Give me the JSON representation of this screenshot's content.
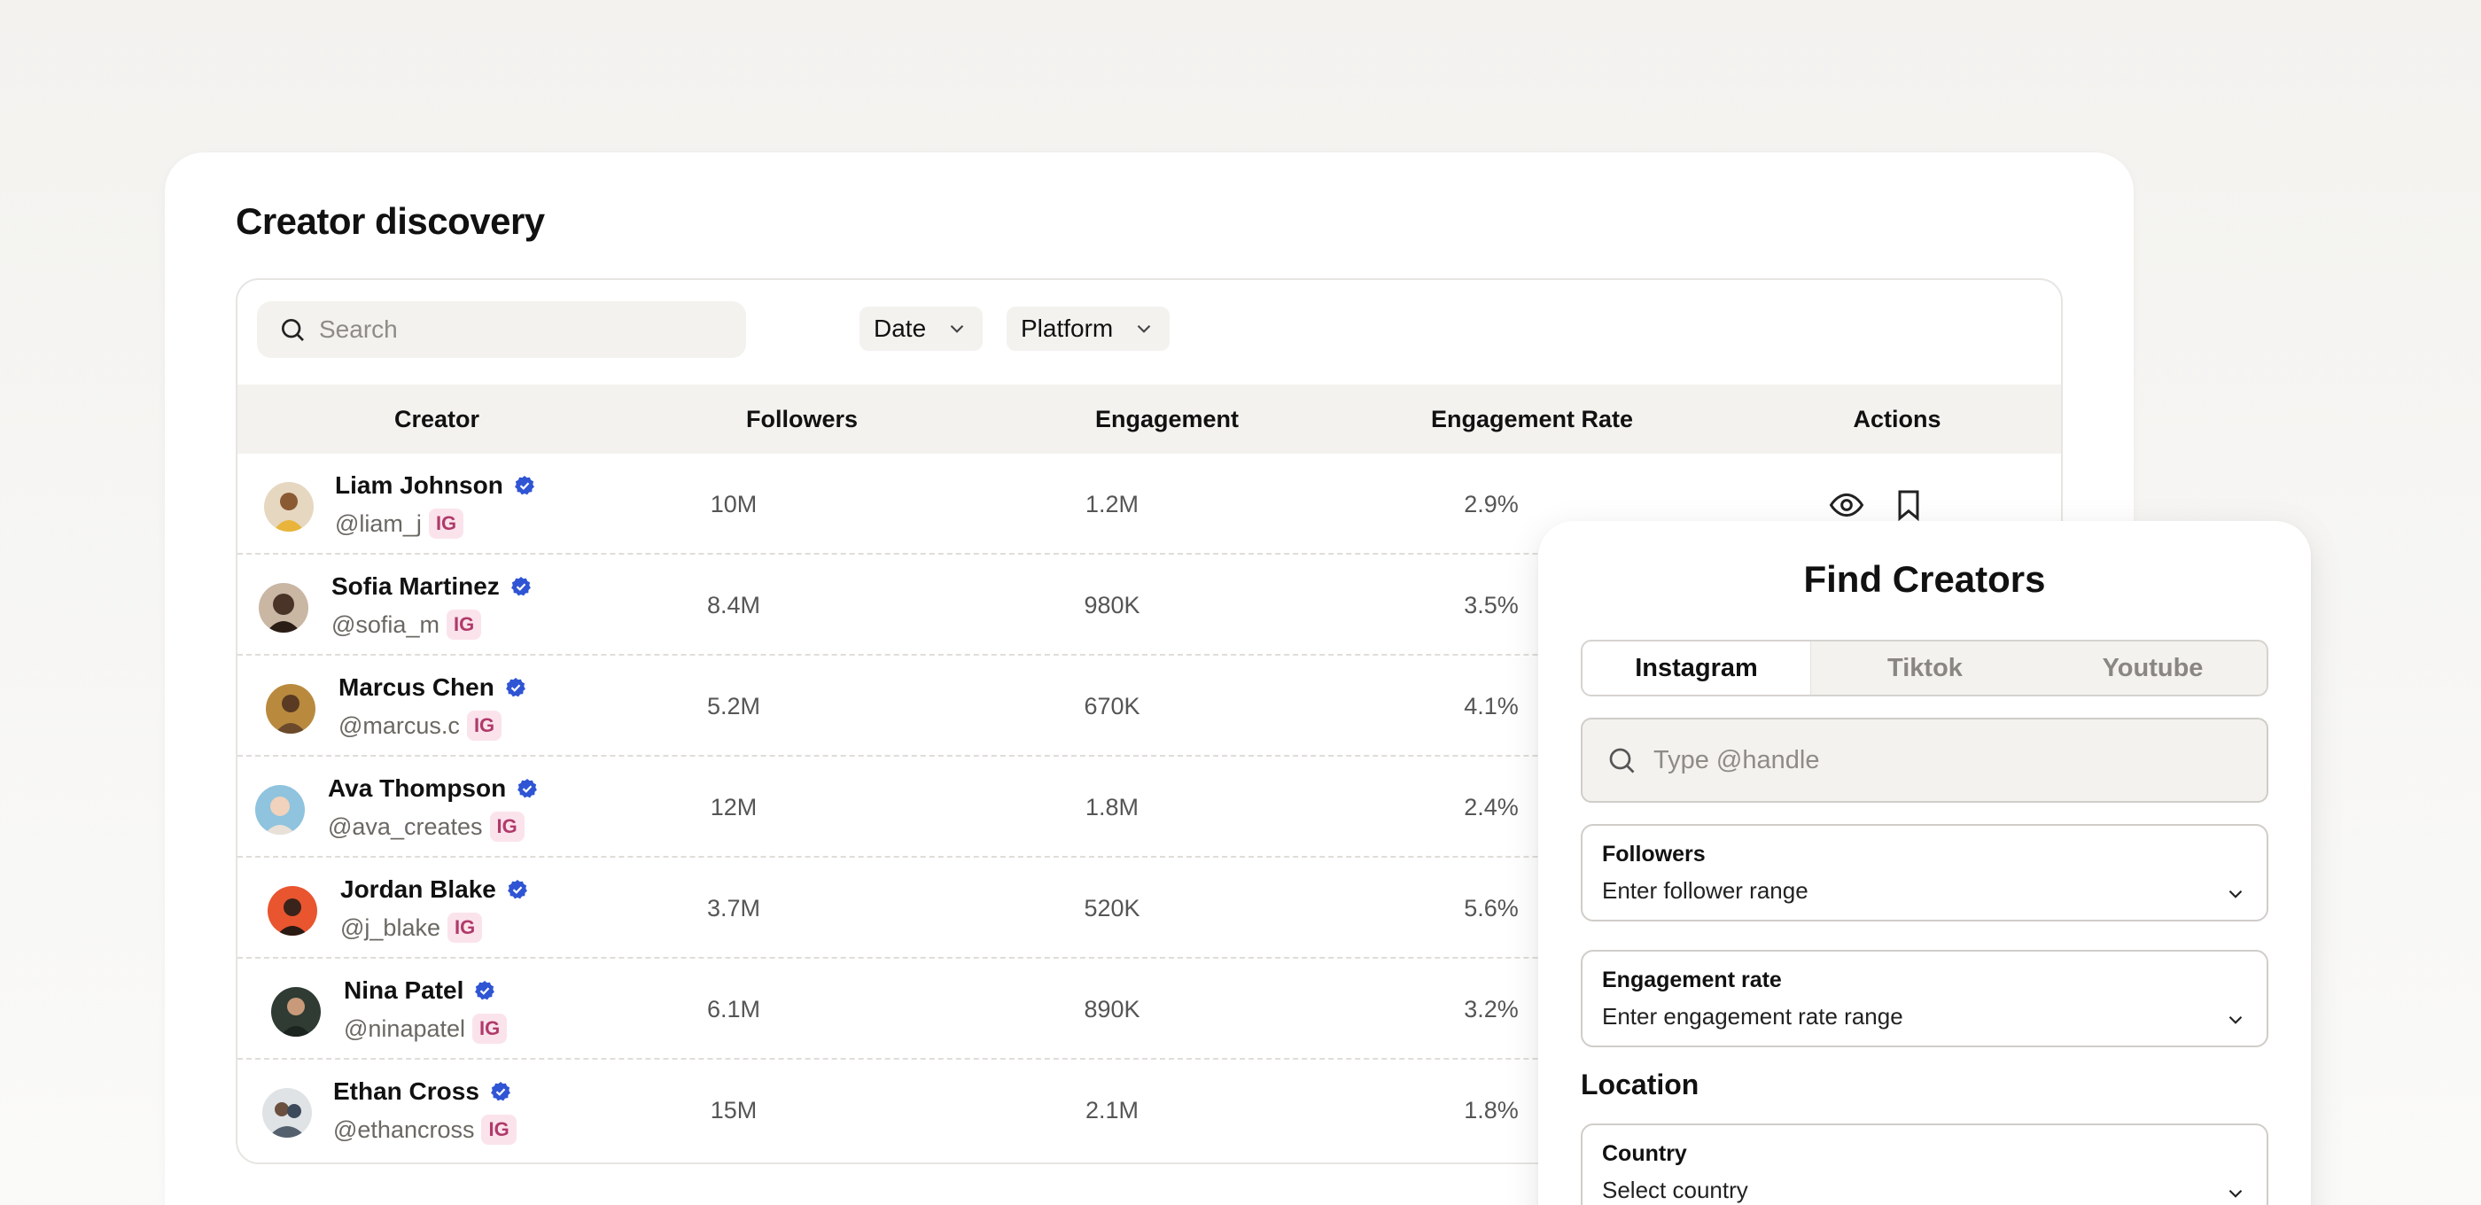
{
  "page": {
    "title": "Creator discovery"
  },
  "toolbar": {
    "search_placeholder": "Search",
    "date_filter": "Date",
    "platform_filter": "Platform"
  },
  "table": {
    "columns": [
      "Creator",
      "Followers",
      "Engagement",
      "Engagement Rate",
      "Actions"
    ],
    "rows": [
      {
        "name": "Liam Johnson",
        "handle": "@liam_j",
        "platform": "IG",
        "followers": "10M",
        "engagement": "1.2M",
        "rate": "2.9%"
      },
      {
        "name": "Sofia Martinez",
        "handle": "@sofia_m",
        "platform": "IG",
        "followers": "8.4M",
        "engagement": "980K",
        "rate": "3.5%"
      },
      {
        "name": "Marcus Chen",
        "handle": "@marcus.c",
        "platform": "IG",
        "followers": "5.2M",
        "engagement": "670K",
        "rate": "4.1%"
      },
      {
        "name": "Ava Thompson",
        "handle": "@ava_creates",
        "platform": "IG",
        "followers": "12M",
        "engagement": "1.8M",
        "rate": "2.4%"
      },
      {
        "name": "Jordan Blake",
        "handle": "@j_blake",
        "platform": "IG",
        "followers": "3.7M",
        "engagement": "520K",
        "rate": "5.6%"
      },
      {
        "name": "Nina Patel",
        "handle": "@ninapatel",
        "platform": "IG",
        "followers": "6.1M",
        "engagement": "890K",
        "rate": "3.2%"
      },
      {
        "name": "Ethan Cross",
        "handle": "@ethancross",
        "platform": "IG",
        "followers": "15M",
        "engagement": "2.1M",
        "rate": "1.8%"
      }
    ]
  },
  "panel": {
    "title": "Find Creators",
    "tabs": [
      "Instagram",
      "Tiktok",
      "Youtube"
    ],
    "active_tab": "Instagram",
    "handle_placeholder": "Type @handle",
    "followers_label": "Followers",
    "followers_value": "Enter follower range",
    "engagement_label": "Engagement rate",
    "engagement_value": "Enter engagement rate range",
    "location_title": "Location",
    "country_label": "Country",
    "country_value": "Select country"
  },
  "colors": {
    "verified": "#2f55d4",
    "badge_bg": "#fbe3ec",
    "badge_text": "#b03a6a"
  },
  "icons": [
    "search-icon",
    "chevron-down-icon",
    "verified-icon",
    "eye-icon",
    "bookmark-icon",
    "avatar"
  ]
}
